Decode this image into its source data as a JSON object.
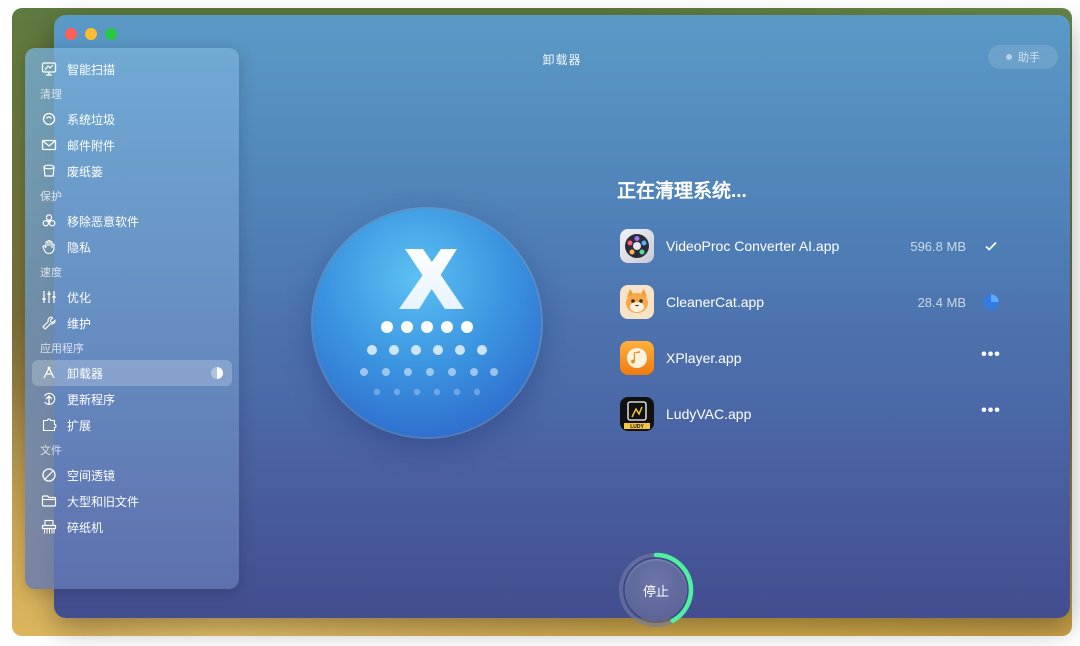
{
  "window": {
    "title": "卸载器",
    "assistant_label": "助手"
  },
  "sidebar": {
    "items": [
      {
        "type": "item",
        "label": "智能扫描",
        "icon": "monitor-icon"
      },
      {
        "type": "section",
        "label": "清理"
      },
      {
        "type": "item",
        "label": "系统垃圾",
        "icon": "trash-hand-icon"
      },
      {
        "type": "item",
        "label": "邮件附件",
        "icon": "mail-icon"
      },
      {
        "type": "item",
        "label": "废纸篓",
        "icon": "bin-icon"
      },
      {
        "type": "section",
        "label": "保护"
      },
      {
        "type": "item",
        "label": "移除恶意软件",
        "icon": "biohazard-icon"
      },
      {
        "type": "item",
        "label": "隐私",
        "icon": "hand-icon"
      },
      {
        "type": "section",
        "label": "速度"
      },
      {
        "type": "item",
        "label": "优化",
        "icon": "sliders-icon"
      },
      {
        "type": "item",
        "label": "维护",
        "icon": "wrench-icon"
      },
      {
        "type": "section",
        "label": "应用程序"
      },
      {
        "type": "item",
        "label": "卸载器",
        "icon": "uninstaller-icon",
        "active": true
      },
      {
        "type": "item",
        "label": "更新程序",
        "icon": "update-icon"
      },
      {
        "type": "item",
        "label": "扩展",
        "icon": "extension-icon"
      },
      {
        "type": "section",
        "label": "文件"
      },
      {
        "type": "item",
        "label": "空间透镜",
        "icon": "lens-icon"
      },
      {
        "type": "item",
        "label": "大型和旧文件",
        "icon": "folder-icon"
      },
      {
        "type": "item",
        "label": "碎纸机",
        "icon": "shredder-icon"
      }
    ]
  },
  "main": {
    "heading": "正在清理系统...",
    "apps": [
      {
        "name": "VideoProc Converter AI.app",
        "size": "596.8 MB",
        "status": "done"
      },
      {
        "name": "CleanerCat.app",
        "size": "28.4 MB",
        "status": "in-progress"
      },
      {
        "name": "XPlayer.app",
        "size": "",
        "status": "pending"
      },
      {
        "name": "LudyVAC.app",
        "size": "",
        "status": "pending"
      }
    ],
    "app_icon_labels": {
      "ludy": "LUDY"
    },
    "stop_label": "停止",
    "stop_progress": 0.42
  },
  "colors": {
    "accent_green": "#4ff0a0",
    "progress_blue": "#2f7ce8"
  }
}
